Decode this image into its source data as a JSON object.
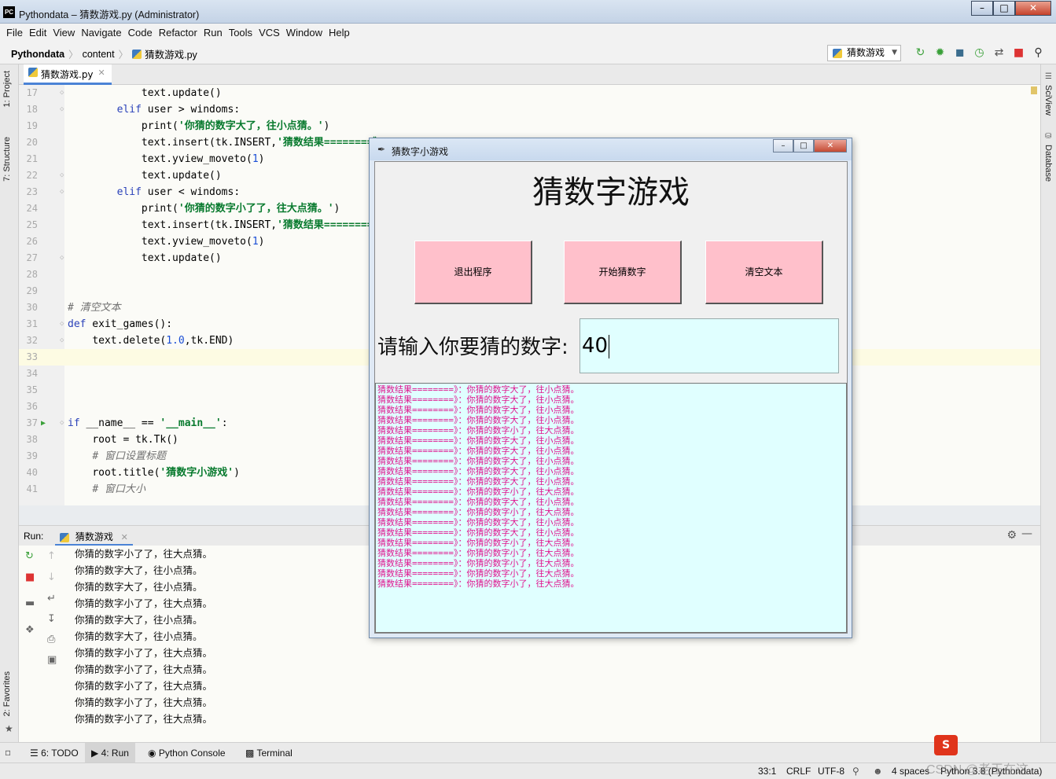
{
  "ide": {
    "window_title": "Pythondata – 猜数游戏.py (Administrator)",
    "app_icon_text": "PC",
    "menu": [
      "File",
      "Edit",
      "View",
      "Navigate",
      "Code",
      "Refactor",
      "Run",
      "Tools",
      "VCS",
      "Window",
      "Help"
    ],
    "breadcrumb": {
      "project": "Pythondata",
      "folder": "content",
      "file": "猜数游戏.py"
    },
    "run_config": "猜数游戏",
    "editor_tab": "猜数游戏.py",
    "left_tools": [
      "1: Project",
      "7: Structure",
      "2: Favorites"
    ],
    "right_tools": [
      "SciView",
      "Database"
    ],
    "code_lines": [
      {
        "n": "17",
        "indent": "            ",
        "parts": [
          [
            "",
            "text.update()"
          ]
        ]
      },
      {
        "n": "18",
        "indent": "        ",
        "parts": [
          [
            "kw",
            "elif"
          ],
          [
            "",
            " user > windoms:"
          ]
        ]
      },
      {
        "n": "19",
        "indent": "            ",
        "parts": [
          [
            "",
            "print("
          ],
          [
            "str",
            "'你猜的数字大了，往小点猜。'"
          ],
          [
            "",
            ")"
          ]
        ]
      },
      {
        "n": "20",
        "indent": "            ",
        "parts": [
          [
            "",
            "text.insert(tk.INSERT,"
          ],
          [
            "str",
            "'猜数结果========》"
          ]
        ]
      },
      {
        "n": "21",
        "indent": "            ",
        "parts": [
          [
            "",
            "text.yview_moveto("
          ],
          [
            "num",
            "1"
          ],
          [
            "",
            ")"
          ]
        ]
      },
      {
        "n": "22",
        "indent": "            ",
        "parts": [
          [
            "",
            "text.update()"
          ]
        ]
      },
      {
        "n": "23",
        "indent": "        ",
        "parts": [
          [
            "kw",
            "elif"
          ],
          [
            "",
            " user < windoms:"
          ]
        ]
      },
      {
        "n": "24",
        "indent": "            ",
        "parts": [
          [
            "",
            "print("
          ],
          [
            "str",
            "'你猜的数字小了了，往大点猜。'"
          ],
          [
            "",
            ")"
          ]
        ]
      },
      {
        "n": "25",
        "indent": "            ",
        "parts": [
          [
            "",
            "text.insert(tk.INSERT,"
          ],
          [
            "str",
            "'猜数结果========》"
          ]
        ]
      },
      {
        "n": "26",
        "indent": "            ",
        "parts": [
          [
            "",
            "text.yview_moveto("
          ],
          [
            "num",
            "1"
          ],
          [
            "",
            ")"
          ]
        ]
      },
      {
        "n": "27",
        "indent": "            ",
        "parts": [
          [
            "",
            "text.update()"
          ]
        ]
      },
      {
        "n": "28",
        "indent": "",
        "parts": []
      },
      {
        "n": "29",
        "indent": "",
        "parts": []
      },
      {
        "n": "30",
        "indent": "",
        "parts": [
          [
            "cmt",
            "# 清空文本"
          ]
        ]
      },
      {
        "n": "31",
        "indent": "",
        "parts": [
          [
            "kw",
            "def"
          ],
          [
            "",
            " exit_games():"
          ]
        ]
      },
      {
        "n": "32",
        "indent": "    ",
        "parts": [
          [
            "",
            "text.delete("
          ],
          [
            "num",
            "1.0"
          ],
          [
            "",
            ",tk.END)"
          ]
        ]
      },
      {
        "n": "33",
        "indent": "",
        "parts": []
      },
      {
        "n": "34",
        "indent": "",
        "parts": []
      },
      {
        "n": "35",
        "indent": "",
        "parts": []
      },
      {
        "n": "36",
        "indent": "",
        "parts": []
      },
      {
        "n": "37",
        "indent": "",
        "parts": [
          [
            "kw",
            "if"
          ],
          [
            "",
            " __name__ == "
          ],
          [
            "str",
            "'__main__'"
          ],
          [
            "",
            ":"
          ]
        ]
      },
      {
        "n": "38",
        "indent": "    ",
        "parts": [
          [
            "",
            "root = tk.Tk()"
          ]
        ]
      },
      {
        "n": "39",
        "indent": "    ",
        "parts": [
          [
            "cmt",
            "# 窗口设置标题"
          ]
        ]
      },
      {
        "n": "40",
        "indent": "    ",
        "parts": [
          [
            "",
            "root.title("
          ],
          [
            "str",
            "'猜数字小游戏'"
          ],
          [
            "",
            ")"
          ]
        ]
      },
      {
        "n": "41",
        "indent": "    ",
        "parts": [
          [
            "cmt",
            "# 窗口大小"
          ]
        ]
      }
    ],
    "current_line": "33",
    "run_panel": {
      "label": "Run:",
      "tab": "猜数游戏",
      "output": [
        "你猜的数字小了了，往大点猜。",
        "你猜的数字大了，往小点猜。",
        "你猜的数字大了，往小点猜。",
        "你猜的数字小了了，往大点猜。",
        "你猜的数字大了，往小点猜。",
        "你猜的数字大了，往小点猜。",
        "你猜的数字小了了，往大点猜。",
        "你猜的数字小了了，往大点猜。",
        "你猜的数字小了了，往大点猜。",
        "你猜的数字小了了，往大点猜。",
        "你猜的数字小了了，往大点猜。"
      ]
    },
    "bottom_tabs": [
      "6: TODO",
      "4: Run",
      "Python Console",
      "Terminal"
    ],
    "status": {
      "position": "33:1",
      "line_sep": "CRLF",
      "encoding": "UTF-8",
      "indent": "4 spaces",
      "interpreter": "Python 3.8 (Pythondata)"
    },
    "watermark": "CSDN @老王在这"
  },
  "tk": {
    "window_title": "猜数字小游戏",
    "heading": "猜数字游戏",
    "buttons": {
      "exit": "退出程序",
      "start": "开始猜数字",
      "clear": "清空文本"
    },
    "prompt": "请输入你要猜的数字:",
    "entry_value": "40",
    "results": [
      "猜数结果========》：你猜的数字大了，往小点猜。",
      "猜数结果========》：你猜的数字大了，往小点猜。",
      "猜数结果========》：你猜的数字大了，往小点猜。",
      "猜数结果========》：你猜的数字大了，往小点猜。",
      "猜数结果========》：你猜的数字小了，往大点猜。",
      "猜数结果========》：你猜的数字大了，往小点猜。",
      "猜数结果========》：你猜的数字大了，往小点猜。",
      "猜数结果========》：你猜的数字大了，往小点猜。",
      "猜数结果========》：你猜的数字大了，往小点猜。",
      "猜数结果========》：你猜的数字大了，往小点猜。",
      "猜数结果========》：你猜的数字小了，往大点猜。",
      "猜数结果========》：你猜的数字大了，往小点猜。",
      "猜数结果========》：你猜的数字小了，往大点猜。",
      "猜数结果========》：你猜的数字大了，往小点猜。",
      "猜数结果========》：你猜的数字大了，往小点猜。",
      "猜数结果========》：你猜的数字小了，往大点猜。",
      "猜数结果========》：你猜的数字小了，往大点猜。",
      "猜数结果========》：你猜的数字小了，往大点猜。",
      "猜数结果========》：你猜的数字小了，往大点猜。",
      "猜数结果========》：你猜的数字小了，往大点猜。"
    ]
  },
  "colors": {
    "tk_button": "#ffc0cb",
    "tk_entry": "#e0ffff",
    "tk_result_text": "#e0168f",
    "ide_accent": "#4b83d6"
  }
}
